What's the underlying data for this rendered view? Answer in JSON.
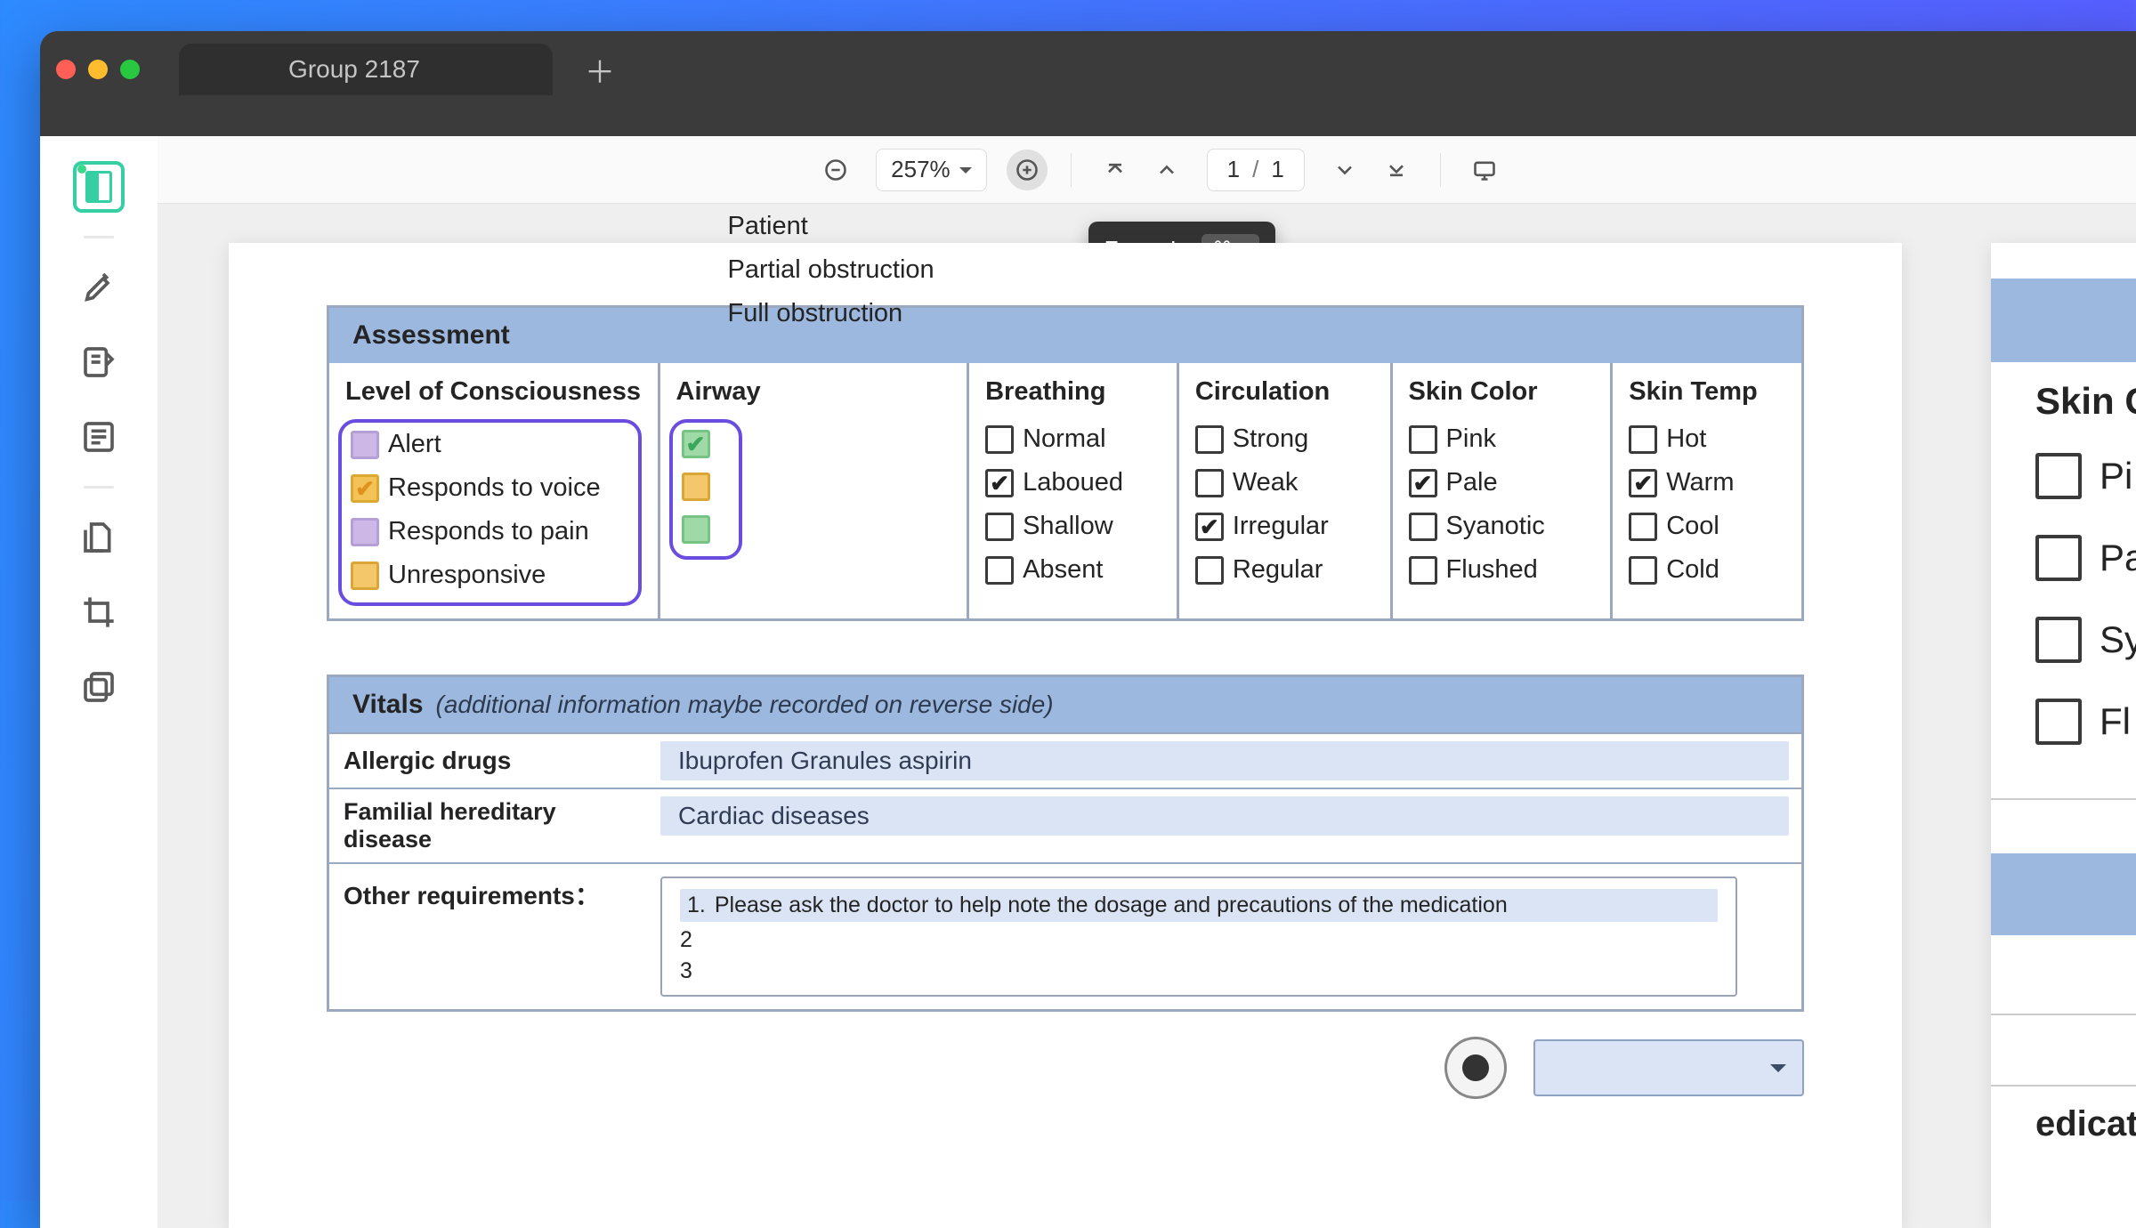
{
  "window": {
    "tab_title": "Group 2187"
  },
  "toolbar": {
    "zoom_percent": "257%",
    "page_current": "1",
    "page_total": "1",
    "tooltip_label": "Zoom In",
    "tooltip_shortcut": "⌘ +"
  },
  "assessment": {
    "title": "Assessment",
    "columns": {
      "loc": {
        "header": "Level of Consciousness",
        "opts": [
          {
            "label": "Alert",
            "style": "purple",
            "checked": false
          },
          {
            "label": "Responds to voice",
            "style": "orange",
            "checked": true
          },
          {
            "label": "Responds to pain",
            "style": "purple",
            "checked": false
          },
          {
            "label": "Unresponsive",
            "style": "orange-hard",
            "checked": false
          }
        ]
      },
      "airway": {
        "header": "Airway",
        "opts": [
          {
            "label": "Patient",
            "style": "green",
            "checked": true
          },
          {
            "label": "Partial obstruction",
            "style": "orange-hard",
            "checked": false
          },
          {
            "label": "Full obstruction",
            "style": "green",
            "checked": false
          }
        ]
      },
      "breathing": {
        "header": "Breathing",
        "opts": [
          {
            "label": "Normal",
            "checked": false
          },
          {
            "label": "Laboued",
            "checked": true
          },
          {
            "label": "Shallow",
            "checked": false
          },
          {
            "label": "Absent",
            "checked": false
          }
        ]
      },
      "circulation": {
        "header": "Circulation",
        "opts": [
          {
            "label": "Strong",
            "checked": false
          },
          {
            "label": "Weak",
            "checked": false
          },
          {
            "label": "Irregular",
            "checked": true
          },
          {
            "label": "Regular",
            "checked": false
          }
        ]
      },
      "skin_color": {
        "header": "Skin Color",
        "opts": [
          {
            "label": "Pink",
            "checked": false
          },
          {
            "label": "Pale",
            "checked": true
          },
          {
            "label": "Syanotic",
            "checked": false
          },
          {
            "label": "Flushed",
            "checked": false
          }
        ]
      },
      "skin_temp": {
        "header": "Skin Temp",
        "opts": [
          {
            "label": "Hot",
            "checked": false
          },
          {
            "label": "Warm",
            "checked": true
          },
          {
            "label": "Cool",
            "checked": false
          },
          {
            "label": "Cold",
            "checked": false
          }
        ]
      }
    }
  },
  "vitals": {
    "title": "Vitals",
    "subtitle": "(additional information maybe recorded on reverse side)",
    "rows": {
      "allergic_label": "Allergic drugs",
      "allergic_value": "Ibuprofen Granules  aspirin",
      "hereditary_label": "Familial hereditary disease",
      "hereditary_value": "Cardiac diseases",
      "other_label": "Other requirements："
    },
    "notes": [
      {
        "n": "1.",
        "text": "Please ask the doctor to help note the dosage and precautions of the medication"
      },
      {
        "n": "2",
        "text": ""
      },
      {
        "n": "3",
        "text": ""
      }
    ]
  },
  "side_page": {
    "skin_header": "Skin C",
    "opts": [
      "Pi",
      "Pa",
      "Sy",
      "Fl"
    ],
    "bottom_label": "edication"
  }
}
